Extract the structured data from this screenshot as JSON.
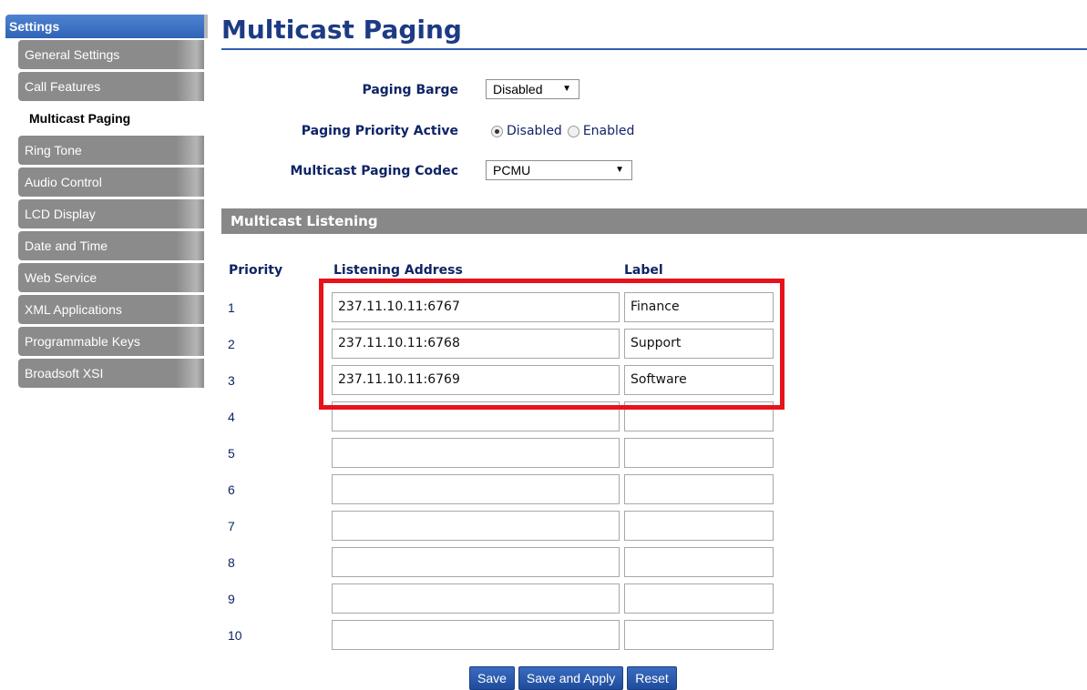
{
  "sidebar": {
    "header": "Settings",
    "items": [
      {
        "label": "General Settings",
        "active": false
      },
      {
        "label": "Call Features",
        "active": false
      },
      {
        "label": "Multicast Paging",
        "active": true
      },
      {
        "label": "Ring Tone",
        "active": false
      },
      {
        "label": "Audio Control",
        "active": false
      },
      {
        "label": "LCD Display",
        "active": false
      },
      {
        "label": "Date and Time",
        "active": false
      },
      {
        "label": "Web Service",
        "active": false
      },
      {
        "label": "XML Applications",
        "active": false
      },
      {
        "label": "Programmable Keys",
        "active": false
      },
      {
        "label": "Broadsoft XSI",
        "active": false
      }
    ]
  },
  "page": {
    "title": "Multicast Paging"
  },
  "form": {
    "paging_barge": {
      "label": "Paging Barge",
      "value": "Disabled"
    },
    "paging_priority": {
      "label": "Paging Priority Active",
      "options": [
        "Disabled",
        "Enabled"
      ],
      "selected": "Disabled"
    },
    "codec": {
      "label": "Multicast Paging Codec",
      "value": "PCMU"
    }
  },
  "listening": {
    "section_title": "Multicast Listening",
    "headers": {
      "priority": "Priority",
      "address": "Listening Address",
      "label": "Label"
    },
    "rows": [
      {
        "priority": "1",
        "address": "237.11.10.11:6767",
        "label": "Finance"
      },
      {
        "priority": "2",
        "address": "237.11.10.11:6768",
        "label": "Support"
      },
      {
        "priority": "3",
        "address": "237.11.10.11:6769",
        "label": "Software"
      },
      {
        "priority": "4",
        "address": "",
        "label": ""
      },
      {
        "priority": "5",
        "address": "",
        "label": ""
      },
      {
        "priority": "6",
        "address": "",
        "label": ""
      },
      {
        "priority": "7",
        "address": "",
        "label": ""
      },
      {
        "priority": "8",
        "address": "",
        "label": ""
      },
      {
        "priority": "9",
        "address": "",
        "label": ""
      },
      {
        "priority": "10",
        "address": "",
        "label": ""
      }
    ]
  },
  "buttons": {
    "save": "Save",
    "save_apply": "Save and Apply",
    "reset": "Reset"
  },
  "colors": {
    "highlight": "#e8121a",
    "title": "#1d3b84",
    "section_bar": "#888888",
    "button": "#2a5bb0"
  }
}
